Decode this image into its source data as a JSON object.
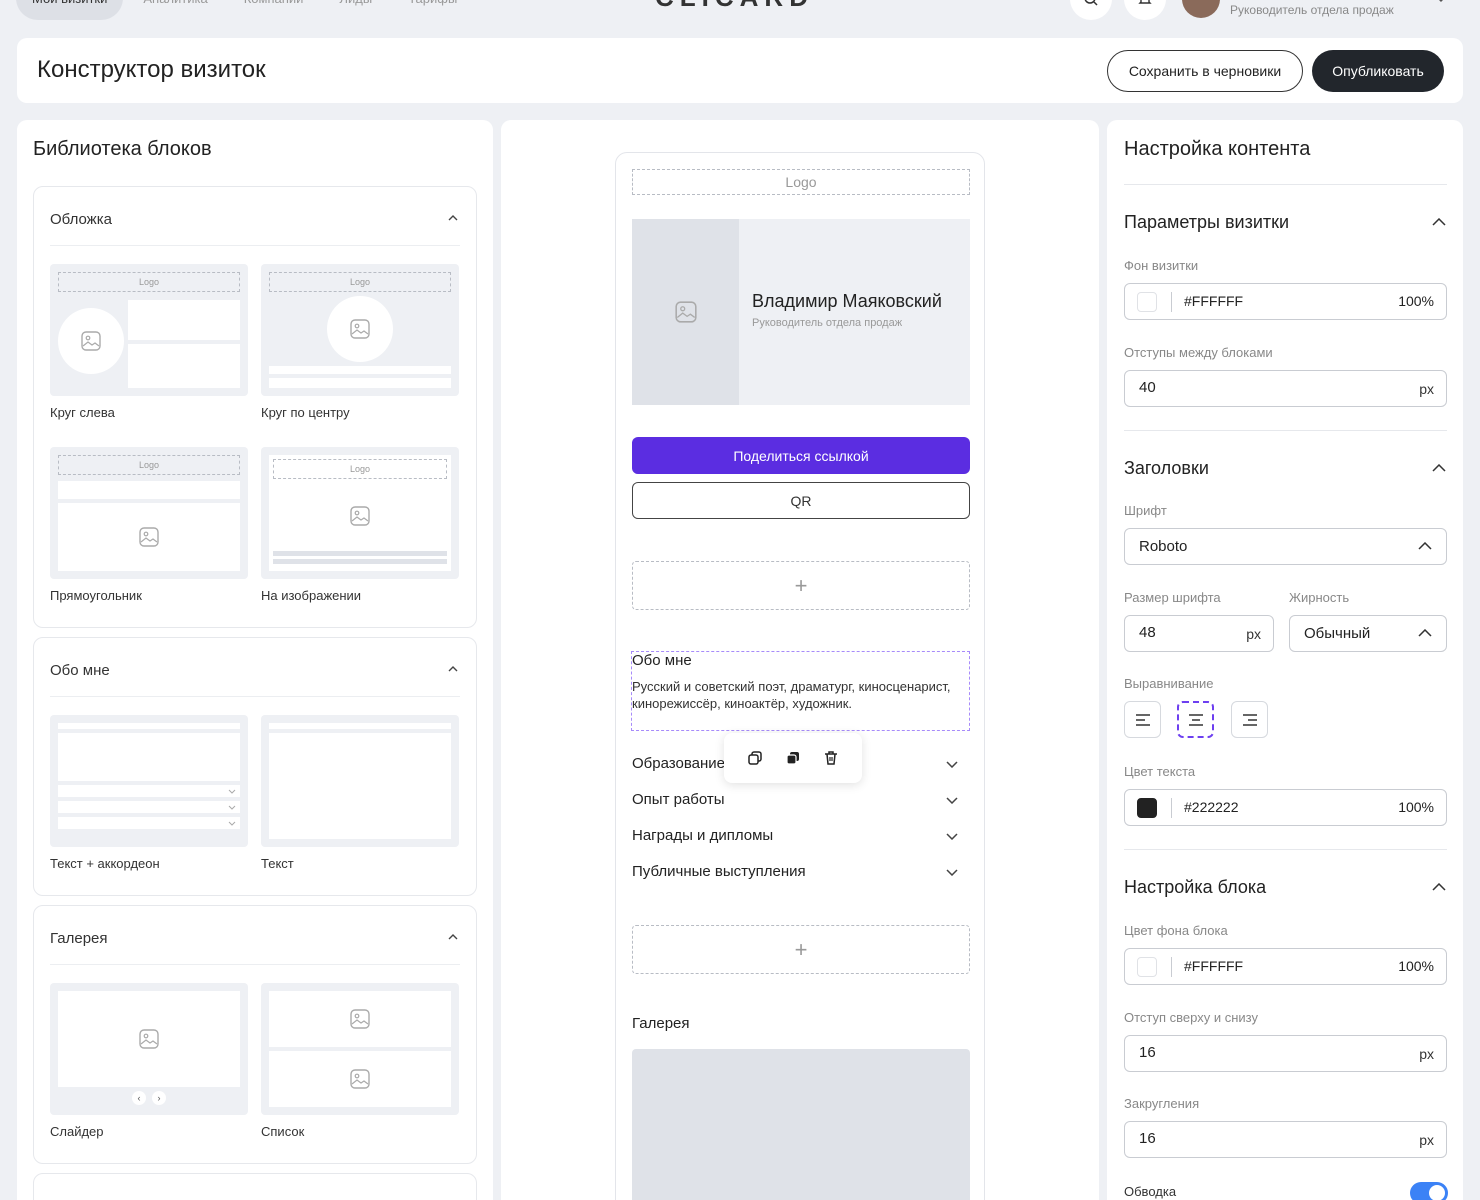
{
  "topnav": {
    "tabs": [
      "Мои визитки",
      "Аналитика",
      "Компании",
      "Лиды",
      "Тарифы"
    ],
    "logo": "CLICARD",
    "user_role": "Руководитель отдела продаж"
  },
  "header": {
    "title": "Конструктор визиток",
    "save_draft": "Сохранить в черновики",
    "publish": "Опубликовать"
  },
  "library": {
    "title": "Библиотека блоков",
    "sections": [
      {
        "title": "Обложка",
        "items": [
          "Круг слева",
          "Круг по центру",
          "Прямоугольник",
          "На изображении"
        ]
      },
      {
        "title": "Обо мне",
        "items": [
          "Текст + аккордеон",
          "Текст"
        ]
      },
      {
        "title": "Галерея",
        "items": [
          "Слайдер",
          "Список"
        ]
      }
    ],
    "logo_text": "Logo"
  },
  "preview": {
    "logo": "Logo",
    "name": "Владимир Маяковский",
    "role": "Руководитель отдела продаж",
    "share": "Поделиться ссылкой",
    "qr": "QR",
    "add": "+",
    "about_title": "Обо мне",
    "about_text": "Русский и советский поэт, драматург, киносценарист, кинорежиссёр, киноактёр, художник.",
    "accordion": [
      "Образование",
      "Опыт работы",
      "Награды и дипломы",
      "Публичные выступления"
    ],
    "gallery_title": "Галерея"
  },
  "settings": {
    "title": "Настройка контента",
    "card_params": {
      "title": "Параметры визитки",
      "bg_label": "Фон визитки",
      "bg_hex": "#FFFFFF",
      "bg_opacity": "100%",
      "gap_label": "Отступы между блоками",
      "gap_value": "40",
      "unit": "px"
    },
    "headings": {
      "title": "Заголовки",
      "font_label": "Шрифт",
      "font_value": "Roboto",
      "size_label": "Размер шрифта",
      "size_value": "48",
      "weight_label": "Жирность",
      "weight_value": "Обычный",
      "align_label": "Выравнивание",
      "color_label": "Цвет текста",
      "color_hex": "#222222",
      "color_opacity": "100%"
    },
    "block": {
      "title": "Настройка блока",
      "bg_label": "Цвет фона блока",
      "bg_hex": "#FFFFFF",
      "bg_opacity": "100%",
      "padding_label": "Отступ сверху и снизу",
      "padding_value": "16",
      "radius_label": "Закругления",
      "radius_value": "16",
      "border_label": "Обводка",
      "border_on": true
    }
  },
  "colors": {
    "accent": "#5B2DE1",
    "dark": "#22262C",
    "toggle": "#3B82F6"
  }
}
